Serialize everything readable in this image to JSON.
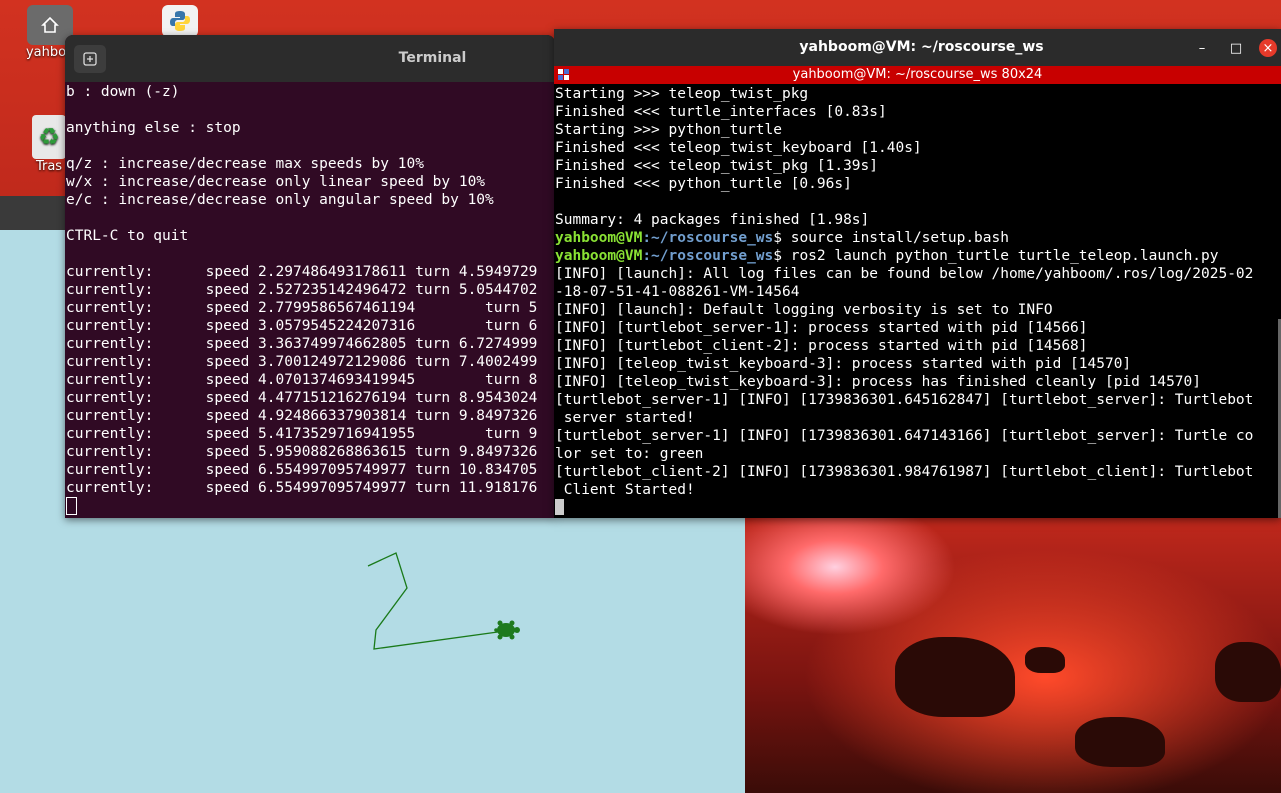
{
  "desktop": {
    "home_icon_label": "yahboo",
    "trash_icon_label": "Tras"
  },
  "turtlesim": {
    "path_color": "#1a7a1a",
    "background_color": "#b3dce5"
  },
  "terminal_left": {
    "title": "Terminal",
    "lines": [
      "b : down (-z)",
      "",
      "anything else : stop",
      "",
      "q/z : increase/decrease max speeds by 10%",
      "w/x : increase/decrease only linear speed by 10%",
      "e/c : increase/decrease only angular speed by 10%",
      "",
      "CTRL-C to quit",
      "",
      "currently:      speed 2.297486493178611 turn 4.5949729",
      "currently:      speed 2.527235142496472 turn 5.0544702",
      "currently:      speed 2.7799586567461194        turn 5",
      "currently:      speed 3.0579545224207316        turn 6",
      "currently:      speed 3.363749974662805 turn 6.7274999",
      "currently:      speed 3.700124972129086 turn 7.4002499",
      "currently:      speed 4.0701374693419945        turn 8",
      "currently:      speed 4.477151216276194 turn 8.9543024",
      "currently:      speed 4.924866337903814 turn 9.8497326",
      "currently:      speed 5.4173529716941955        turn 9",
      "currently:      speed 5.959088268863615 turn 9.8497326",
      "currently:      speed 6.554997095749977 turn 10.834705",
      "currently:      speed 6.554997095749977 turn 11.918176"
    ]
  },
  "terminal_right": {
    "title": "yahboom@VM: ~/roscourse_ws",
    "tab_title": "yahboom@VM: ~/roscourse_ws 80x24",
    "minimize": "–",
    "maximize": "□",
    "close": "×",
    "prompt_user": "yahboom@VM",
    "prompt_path": ":~/roscourse_ws",
    "lines": [
      {
        "t": "Starting >>> teleop_twist_pkg"
      },
      {
        "t": "Finished <<< turtle_interfaces [0.83s]"
      },
      {
        "t": "Starting >>> python_turtle"
      },
      {
        "t": "Finished <<< teleop_twist_keyboard [1.40s]"
      },
      {
        "t": "Finished <<< teleop_twist_pkg [1.39s]"
      },
      {
        "t": "Finished <<< python_turtle [0.96s]"
      },
      {
        "t": ""
      },
      {
        "t": "Summary: 4 packages finished [1.98s]"
      },
      {
        "prompt": true,
        "t": "$ source install/setup.bash"
      },
      {
        "prompt": true,
        "t": "$ ros2 launch python_turtle turtle_teleop.launch.py"
      },
      {
        "t": "[INFO] [launch]: All log files can be found below /home/yahboom/.ros/log/2025-02"
      },
      {
        "t": "-18-07-51-41-088261-VM-14564"
      },
      {
        "t": "[INFO] [launch]: Default logging verbosity is set to INFO"
      },
      {
        "t": "[INFO] [turtlebot_server-1]: process started with pid [14566]"
      },
      {
        "t": "[INFO] [turtlebot_client-2]: process started with pid [14568]"
      },
      {
        "t": "[INFO] [teleop_twist_keyboard-3]: process started with pid [14570]"
      },
      {
        "t": "[INFO] [teleop_twist_keyboard-3]: process has finished cleanly [pid 14570]"
      },
      {
        "t": "[turtlebot_server-1] [INFO] [1739836301.645162847] [turtlebot_server]: Turtlebot"
      },
      {
        "t": " server started!"
      },
      {
        "t": "[turtlebot_server-1] [INFO] [1739836301.647143166] [turtlebot_server]: Turtle co"
      },
      {
        "t": "lor set to: green"
      },
      {
        "t": "[turtlebot_client-2] [INFO] [1739836301.984761987] [turtlebot_client]: Turtlebot"
      },
      {
        "t": " Client Started!"
      }
    ]
  }
}
